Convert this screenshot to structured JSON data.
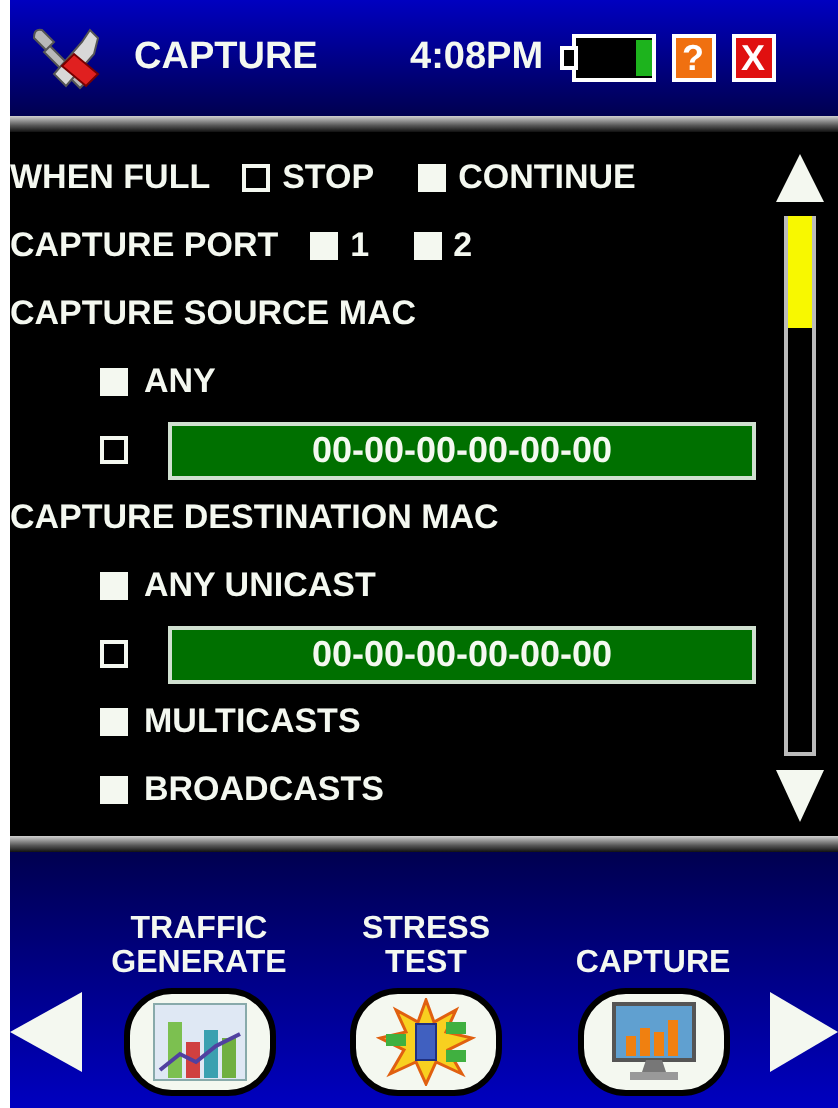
{
  "header": {
    "title": "CAPTURE",
    "time": "4:08PM",
    "help": "?",
    "close": "X"
  },
  "rows": [
    {
      "kind": "choices",
      "label": "WHEN FULL",
      "options": [
        {
          "label": "STOP",
          "checked": false
        },
        {
          "label": "CONTINUE",
          "checked": true
        }
      ]
    },
    {
      "kind": "choices",
      "label": "CAPTURE PORT",
      "options": [
        {
          "label": "1",
          "checked": true
        },
        {
          "label": "2",
          "checked": true
        }
      ]
    },
    {
      "kind": "heading",
      "label": "CAPTURE SOURCE MAC"
    },
    {
      "kind": "checkbox",
      "label": "ANY",
      "checked": true
    },
    {
      "kind": "mac",
      "value": "00-00-00-00-00-00",
      "checked": false
    },
    {
      "kind": "heading",
      "label": "CAPTURE DESTINATION MAC"
    },
    {
      "kind": "checkbox",
      "label": "ANY UNICAST",
      "checked": true
    },
    {
      "kind": "mac",
      "value": "00-00-00-00-00-00",
      "checked": false
    },
    {
      "kind": "checkbox",
      "label": "MULTICASTS",
      "checked": true
    },
    {
      "kind": "checkbox",
      "label": "BROADCASTS",
      "checked": true
    }
  ],
  "nav": [
    {
      "label": "TRAFFIC\nGENERATE",
      "kind": "chart"
    },
    {
      "label": "STRESS\nTEST",
      "kind": "burst"
    },
    {
      "label": "CAPTURE",
      "kind": "monitor"
    }
  ]
}
